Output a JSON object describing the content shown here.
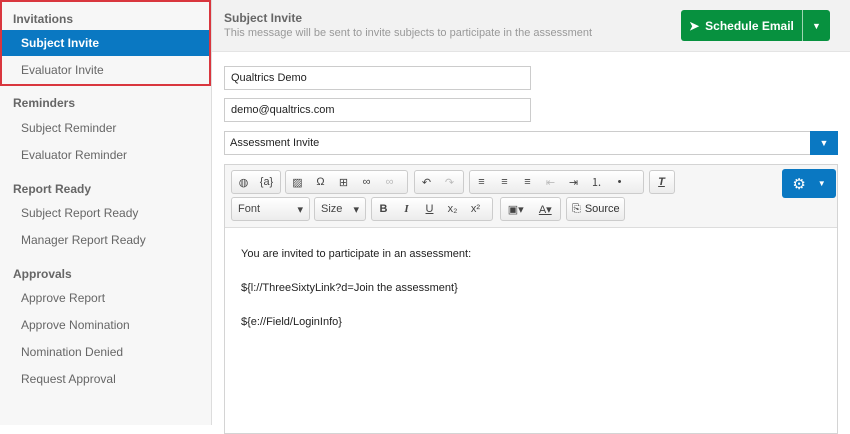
{
  "sidebar": {
    "sections": [
      {
        "title": "Invitations",
        "items": [
          "Subject Invite",
          "Evaluator Invite"
        ]
      },
      {
        "title": "Reminders",
        "items": [
          "Subject Reminder",
          "Evaluator Reminder"
        ]
      },
      {
        "title": "Report Ready",
        "items": [
          "Subject Report Ready",
          "Manager Report Ready"
        ]
      },
      {
        "title": "Approvals",
        "items": [
          "Approve Report",
          "Approve Nomination",
          "Nomination Denied",
          "Request Approval"
        ]
      }
    ]
  },
  "header": {
    "title": "Subject Invite",
    "subtitle": "This message will be sent to invite subjects to participate in the assessment",
    "schedule_label": "Schedule Email"
  },
  "form": {
    "from_name": "Qualtrics Demo",
    "reply_to": "demo@qualtrics.com",
    "subject": "Assessment Invite"
  },
  "toolbar": {
    "font": "Font",
    "size": "Size",
    "source": "Source"
  },
  "editor": {
    "lines": [
      "You are invited to participate in an assessment:",
      "${l://ThreeSixtyLink?d=Join the assessment}",
      "${e://Field/LoginInfo}"
    ]
  },
  "colors": {
    "accent": "#0a78c2",
    "green": "#07913f",
    "highlight": "#d9363e"
  }
}
